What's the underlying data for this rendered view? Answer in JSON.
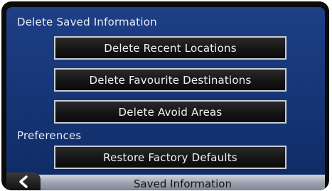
{
  "delete_section": {
    "heading": "Delete Saved Information",
    "buttons": {
      "recent_locations": "Delete Recent Locations",
      "favourite_destinations": "Delete Favourite Destinations",
      "avoid_areas": "Delete Avoid Areas"
    }
  },
  "preferences_section": {
    "heading": "Preferences",
    "buttons": {
      "restore_defaults": "Restore Factory Defaults"
    }
  },
  "bottom_bar": {
    "title": "Saved Information",
    "back_icon": "chevron-left-icon"
  }
}
